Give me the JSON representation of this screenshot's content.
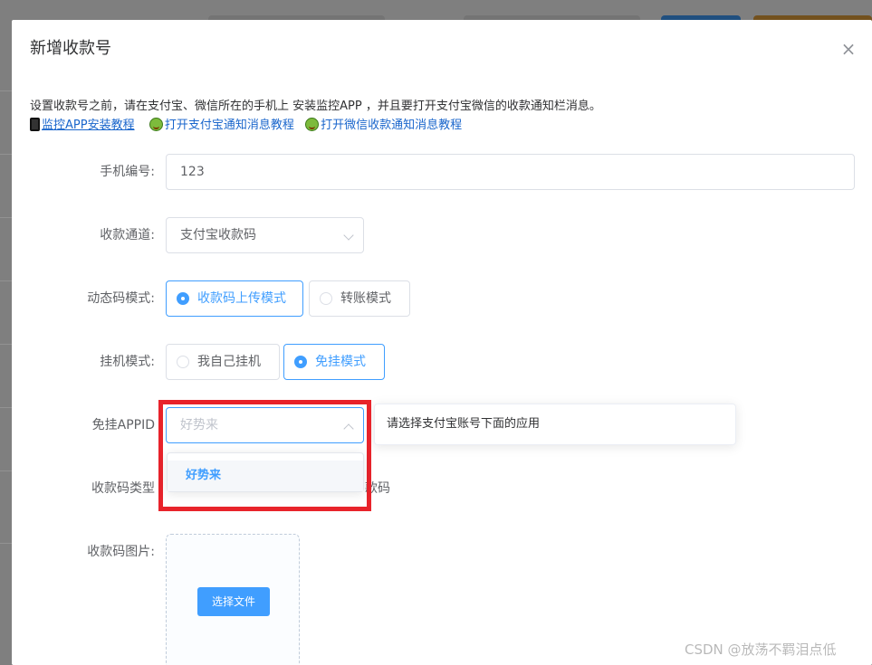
{
  "dialog": {
    "title": "新增收款号",
    "close_symbol": "×"
  },
  "notice": {
    "text": "设置收款号之前，请在支付宝、微信所在的手机上 安装监控APP ，并且要打开支付宝微信的收款通知栏消息。",
    "links": [
      {
        "icon": "mobile-phone-icon",
        "label": "监控APP安装教程"
      },
      {
        "icon": "green-face-icon",
        "label": "打开支付宝通知消息教程"
      },
      {
        "icon": "green-face-icon",
        "label": "打开微信收款通知消息教程"
      }
    ]
  },
  "form": {
    "phone_no": {
      "label": "手机编号:",
      "value": "123"
    },
    "channel": {
      "label": "收款通道:",
      "value": "支付宝收款码"
    },
    "dynamic_mode": {
      "label": "动态码模式:",
      "options": [
        "收款码上传模式",
        "转账模式"
      ],
      "selected": 0
    },
    "hang_mode": {
      "label": "挂机模式:",
      "options": [
        "我自己挂机",
        "免挂模式"
      ],
      "selected": 1
    },
    "appid": {
      "label": "免挂APPID",
      "placeholder": "好势来",
      "tooltip": "请选择支付宝账号下面的应用",
      "dropdown_options": [
        "好势来"
      ]
    },
    "code_type": {
      "label": "收款码类型",
      "partial_text": "款码"
    },
    "code_image": {
      "label": "收款码图片:",
      "button": "选择文件"
    }
  },
  "watermark": "CSDN @放荡不羁泪点低",
  "colors": {
    "primary": "#409eff",
    "highlight": "#e8232b",
    "link": "#1a66cc"
  }
}
